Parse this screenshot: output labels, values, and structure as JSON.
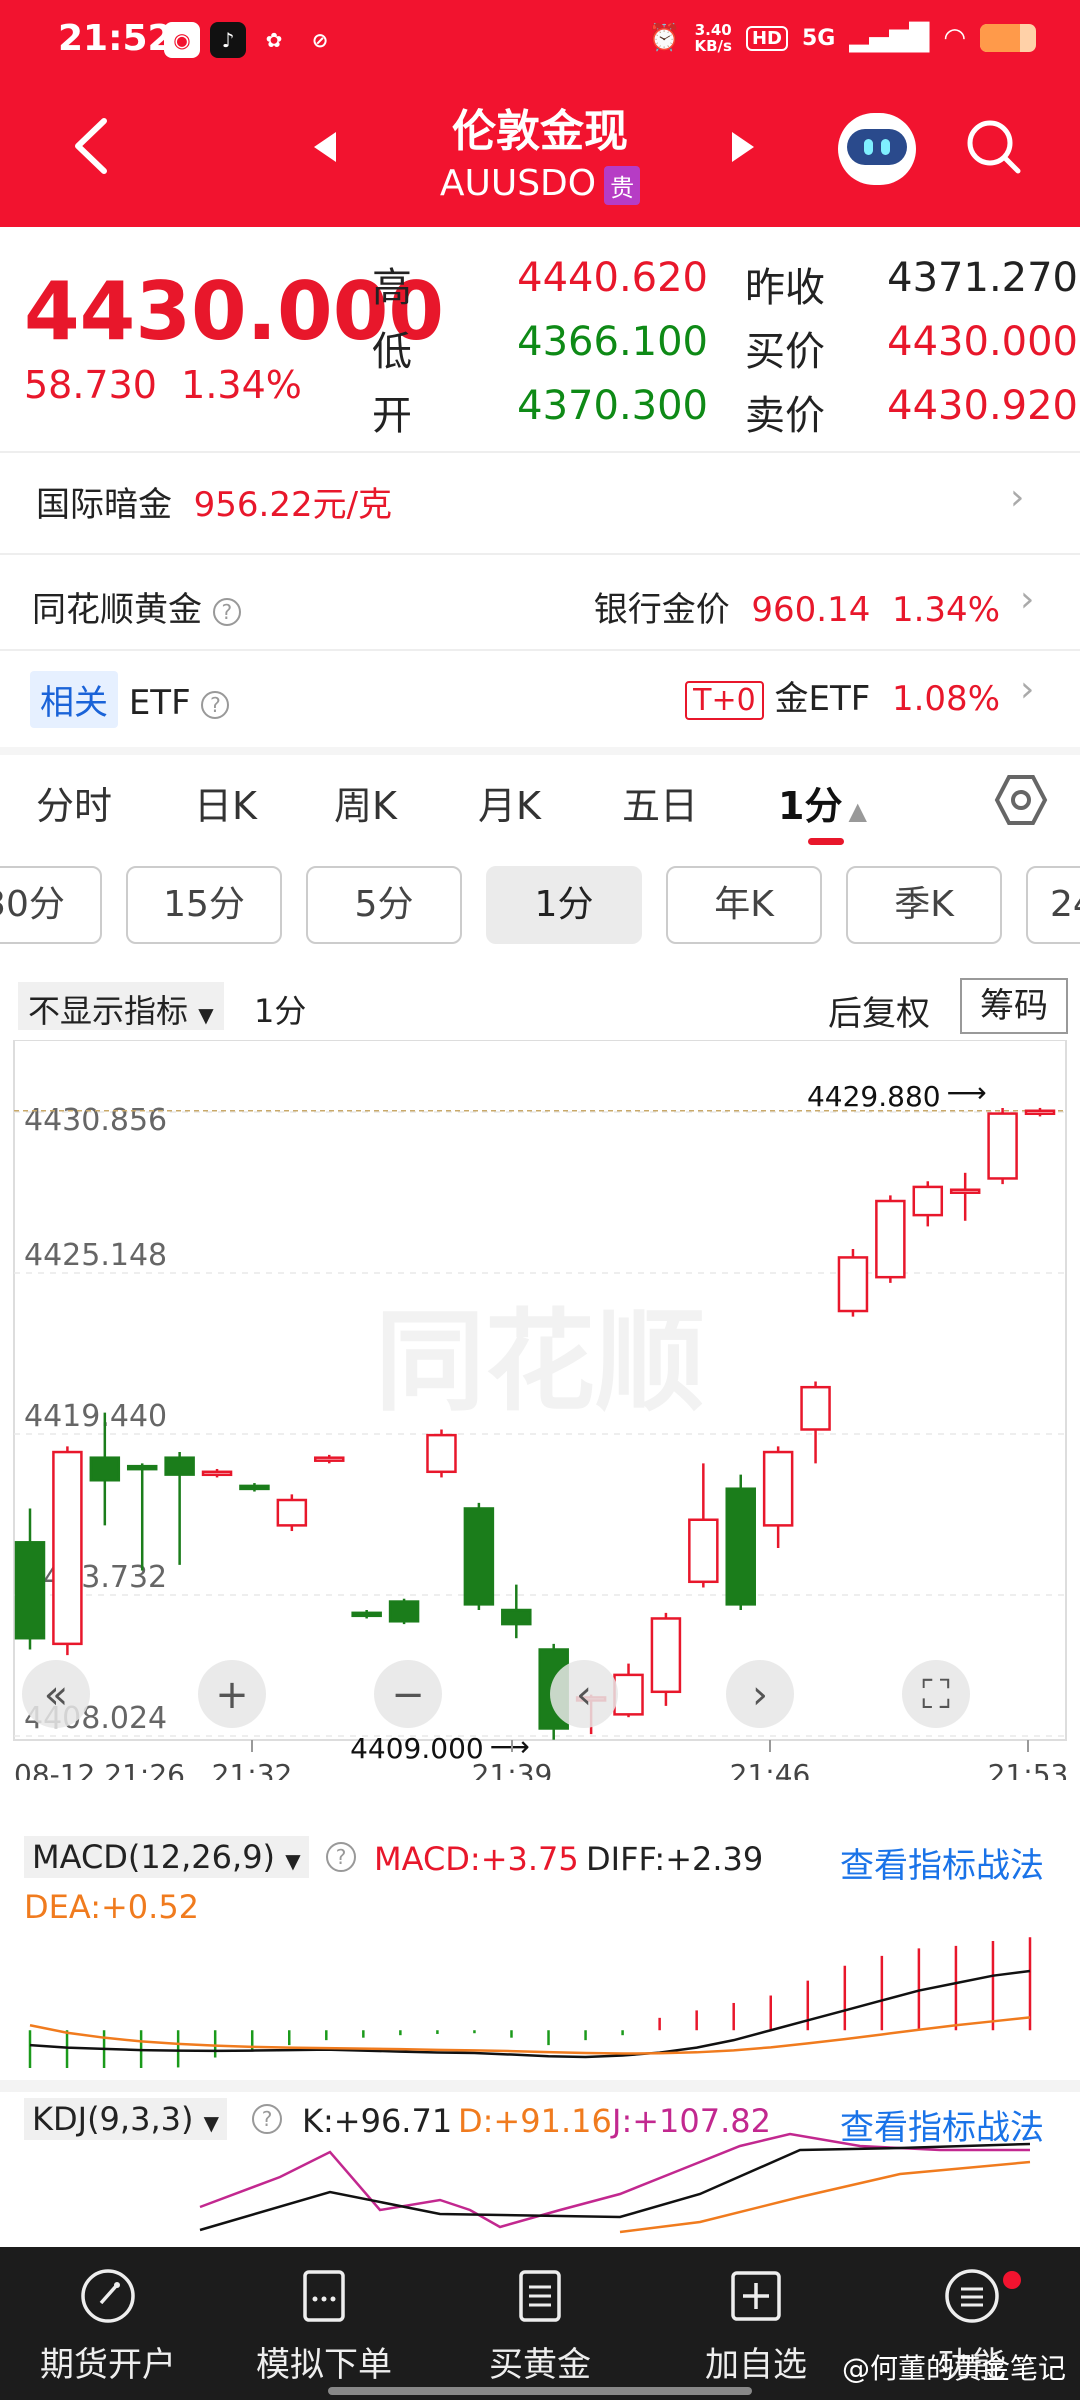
{
  "status": {
    "time": "21:52",
    "speed_top": "3.40",
    "speed_bottom": "KB/s",
    "hd": "HD",
    "net": "5G"
  },
  "header": {
    "title": "伦敦金现",
    "symbol": "AUUSDO",
    "tag": "贵"
  },
  "quote": {
    "price": "4430.000",
    "change": "58.730",
    "change_pct": "1.34%",
    "high_label": "高",
    "high": "4440.620",
    "low_label": "低",
    "low": "4366.100",
    "open_label": "开",
    "open": "4370.300",
    "prev_label": "昨收",
    "prev": "4371.270",
    "bid_label": "买价",
    "bid": "4430.000",
    "ask_label": "卖价",
    "ask": "4430.920",
    "intl_label": "国际暗金",
    "intl_value": "956.22元/克",
    "ths_label": "同花顺黄金",
    "bank_label": "银行金价",
    "bank_value": "960.14",
    "bank_pct": "1.34%",
    "related_tag": "相关",
    "related_label": "ETF",
    "t0": "T+0",
    "etf_label": "金ETF",
    "etf_pct": "1.08%"
  },
  "tabs": [
    "分时",
    "日K",
    "周K",
    "月K",
    "五日",
    "1分"
  ],
  "subtabs": [
    "30分",
    "15分",
    "5分",
    "1分",
    "年K",
    "季K",
    "24"
  ],
  "ctrl": {
    "indicator_select": "不显示指标",
    "period": "1分",
    "fq": "后复权",
    "chou": "筹码"
  },
  "chart_data": {
    "type": "candlestick",
    "y_ticks": [
      "4430.856",
      "4425.148",
      "4419.440",
      "4413.732",
      "4408.024"
    ],
    "ylim": [
      4408.024,
      4430.856
    ],
    "x_ticks": [
      "08-12 21:26",
      "21:32",
      "21:39",
      "21:46",
      "21:53"
    ],
    "max_label": "4429.880",
    "min_label": "4409.000",
    "watermark": "同花顺",
    "candles": [
      {
        "o": 4415.6,
        "c": 4412.2,
        "h": 4416.8,
        "l": 4411.8
      },
      {
        "o": 4412.0,
        "c": 4418.8,
        "h": 4419.0,
        "l": 4411.6
      },
      {
        "o": 4418.6,
        "c": 4417.8,
        "h": 4420.2,
        "l": 4416.2
      },
      {
        "o": 4418.3,
        "c": 4418.2,
        "h": 4418.4,
        "l": 4414.6
      },
      {
        "o": 4418.6,
        "c": 4418.0,
        "h": 4418.8,
        "l": 4414.8
      },
      {
        "o": 4418.0,
        "c": 4418.1,
        "h": 4418.2,
        "l": 4417.9
      },
      {
        "o": 4417.6,
        "c": 4417.5,
        "h": 4417.7,
        "l": 4417.4
      },
      {
        "o": 4416.2,
        "c": 4417.1,
        "h": 4417.3,
        "l": 4416.0
      },
      {
        "o": 4418.5,
        "c": 4418.6,
        "h": 4418.7,
        "l": 4418.4
      },
      {
        "o": 4413.1,
        "c": 4413.0,
        "h": 4413.2,
        "l": 4412.9
      },
      {
        "o": 4413.5,
        "c": 4412.8,
        "h": 4413.6,
        "l": 4412.7
      },
      {
        "o": 4418.1,
        "c": 4419.4,
        "h": 4419.6,
        "l": 4417.9
      },
      {
        "o": 4416.8,
        "c": 4413.4,
        "h": 4417.0,
        "l": 4413.2
      },
      {
        "o": 4413.2,
        "c": 4412.7,
        "h": 4414.1,
        "l": 4412.2
      },
      {
        "o": 4411.8,
        "c": 4409.0,
        "h": 4412.0,
        "l": 4408.6
      },
      {
        "o": 4410.0,
        "c": 4410.1,
        "h": 4410.2,
        "l": 4408.8
      },
      {
        "o": 4409.5,
        "c": 4410.9,
        "h": 4411.3,
        "l": 4409.4
      },
      {
        "o": 4410.3,
        "c": 4412.9,
        "h": 4413.1,
        "l": 4409.8
      },
      {
        "o": 4414.2,
        "c": 4416.4,
        "h": 4418.4,
        "l": 4414.0
      },
      {
        "o": 4417.5,
        "c": 4413.4,
        "h": 4418.0,
        "l": 4413.2
      },
      {
        "o": 4416.2,
        "c": 4418.8,
        "h": 4419.0,
        "l": 4415.4
      },
      {
        "o": 4419.6,
        "c": 4421.1,
        "h": 4421.3,
        "l": 4418.4
      },
      {
        "o": 4423.8,
        "c": 4425.7,
        "h": 4426.0,
        "l": 4423.6
      },
      {
        "o": 4425.0,
        "c": 4427.7,
        "h": 4427.9,
        "l": 4424.8
      },
      {
        "o": 4427.2,
        "c": 4428.2,
        "h": 4428.4,
        "l": 4426.8
      },
      {
        "o": 4428.0,
        "c": 4428.1,
        "h": 4428.7,
        "l": 4427.0
      },
      {
        "o": 4428.5,
        "c": 4430.8,
        "h": 4431.0,
        "l": 4428.3
      },
      {
        "o": 4430.8,
        "c": 4430.9,
        "h": 4431.0,
        "l": 4430.7
      }
    ]
  },
  "macd": {
    "label": "MACD(12,26,9)",
    "macd": "MACD:+3.75",
    "diff": "DIFF:+2.39",
    "dea": "DEA:+0.52",
    "link": "查看指标战法",
    "bars": [
      -2.6,
      -2.4,
      -2.1,
      -1.8,
      -1.5,
      -1.1,
      -0.8,
      -0.6,
      -0.4,
      -0.3,
      -0.2,
      -0.15,
      -0.12,
      -0.3,
      -0.6,
      -0.4,
      -0.2,
      0.5,
      0.8,
      1.1,
      1.4,
      2.0,
      2.6,
      3.0,
      3.3,
      3.4,
      3.6,
      3.75
    ],
    "diff_line": [
      -0.6,
      -0.7,
      -0.75,
      -0.8,
      -0.82,
      -0.83,
      -0.82,
      -0.8,
      -0.78,
      -0.82,
      -0.86,
      -0.9,
      -0.92,
      -0.98,
      -1.05,
      -1.08,
      -1.02,
      -0.9,
      -0.7,
      -0.4,
      0.0,
      0.4,
      0.8,
      1.2,
      1.6,
      1.9,
      2.2,
      2.39
    ],
    "dea_line": [
      0.2,
      -0.1,
      -0.3,
      -0.45,
      -0.55,
      -0.62,
      -0.67,
      -0.7,
      -0.72,
      -0.74,
      -0.76,
      -0.79,
      -0.81,
      -0.84,
      -0.88,
      -0.92,
      -0.94,
      -0.93,
      -0.89,
      -0.81,
      -0.69,
      -0.53,
      -0.36,
      -0.17,
      0.02,
      0.2,
      0.36,
      0.52
    ],
    "ylim": [
      -1.2,
      3.8
    ]
  },
  "kdj": {
    "label": "KDJ(9,3,3)",
    "k": "K:+96.71",
    "d": "D:+91.16",
    "j": "J:+107.82",
    "link": "查看指标战法"
  },
  "nav": [
    "期货开户",
    "模拟下单",
    "买黄金",
    "加自选",
    "功能"
  ],
  "watermark_text": "@何董的黄金笔记"
}
